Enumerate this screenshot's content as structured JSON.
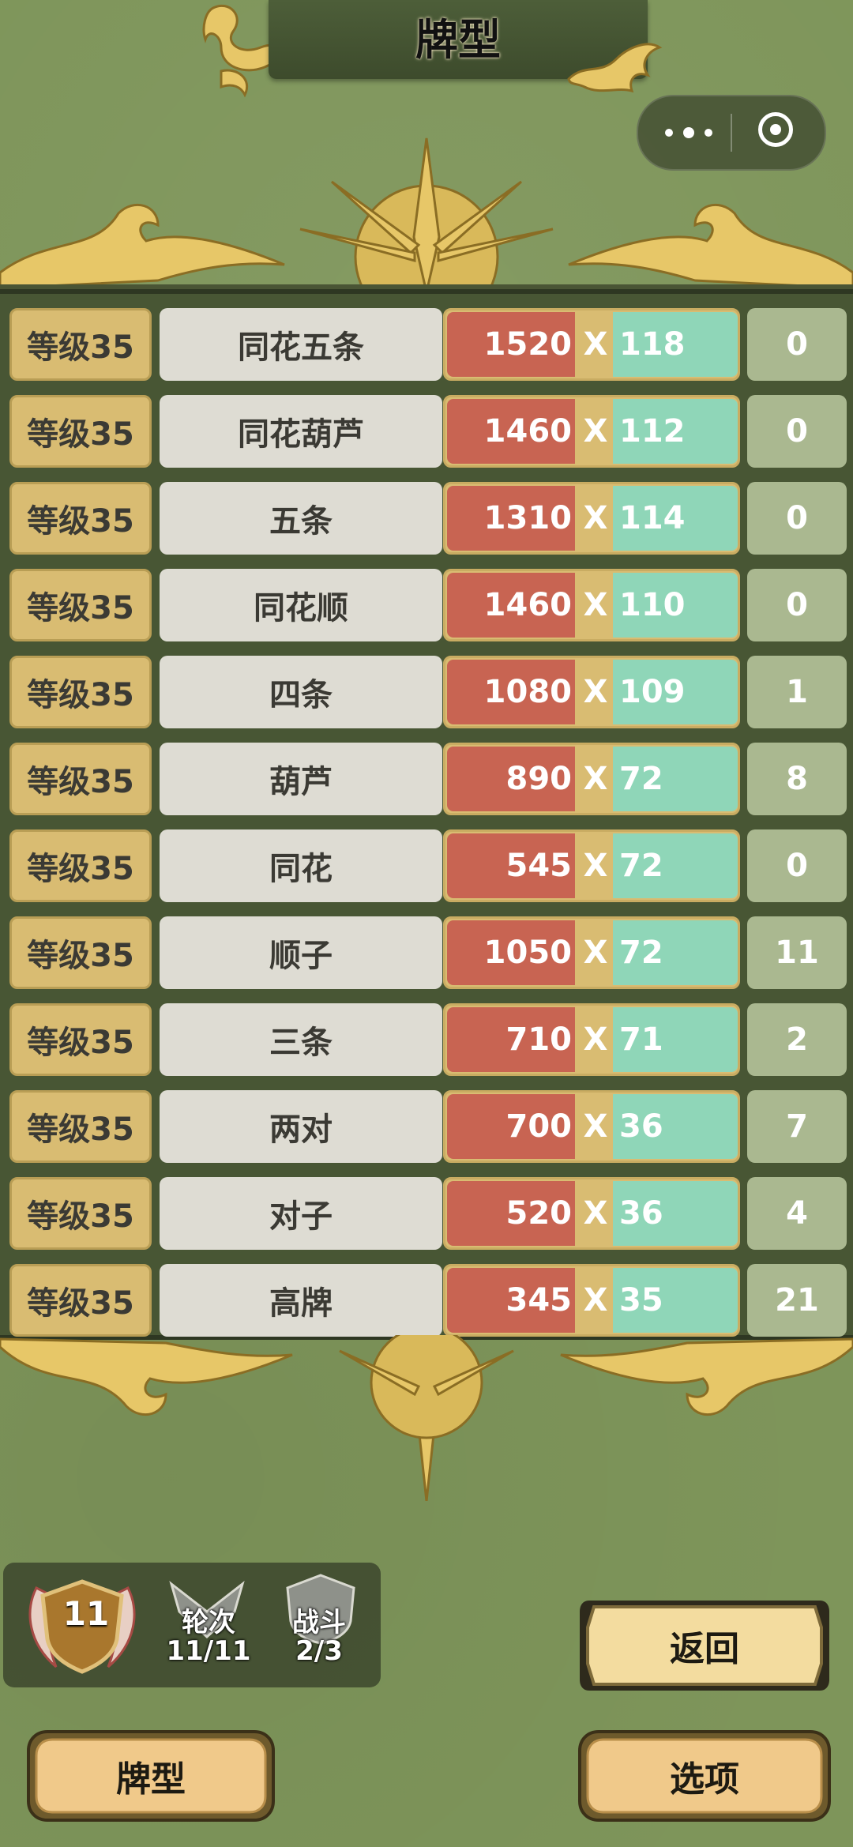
{
  "title": "牌型",
  "capsule": {
    "more_icon": "more-dots-icon",
    "close_icon": "target-close-icon"
  },
  "hands": [
    {
      "level": "等级35",
      "name": "同花五条",
      "chips": "1520",
      "x": "X",
      "mult": "118",
      "count": "0"
    },
    {
      "level": "等级35",
      "name": "同花葫芦",
      "chips": "1460",
      "x": "X",
      "mult": "112",
      "count": "0"
    },
    {
      "level": "等级35",
      "name": "五条",
      "chips": "1310",
      "x": "X",
      "mult": "114",
      "count": "0"
    },
    {
      "level": "等级35",
      "name": "同花顺",
      "chips": "1460",
      "x": "X",
      "mult": "110",
      "count": "0"
    },
    {
      "level": "等级35",
      "name": "四条",
      "chips": "1080",
      "x": "X",
      "mult": "109",
      "count": "1"
    },
    {
      "level": "等级35",
      "name": "葫芦",
      "chips": "890",
      "x": "X",
      "mult": "72",
      "count": "8"
    },
    {
      "level": "等级35",
      "name": "同花",
      "chips": "545",
      "x": "X",
      "mult": "72",
      "count": "0"
    },
    {
      "level": "等级35",
      "name": "顺子",
      "chips": "1050",
      "x": "X",
      "mult": "72",
      "count": "11"
    },
    {
      "level": "等级35",
      "name": "三条",
      "chips": "710",
      "x": "X",
      "mult": "71",
      "count": "2"
    },
    {
      "level": "等级35",
      "name": "两对",
      "chips": "700",
      "x": "X",
      "mult": "36",
      "count": "7"
    },
    {
      "level": "等级35",
      "name": "对子",
      "chips": "520",
      "x": "X",
      "mult": "36",
      "count": "4"
    },
    {
      "level": "等级35",
      "name": "高牌",
      "chips": "345",
      "x": "X",
      "mult": "35",
      "count": "21"
    }
  ],
  "status": {
    "level": "11",
    "round_label": "轮次",
    "round_value": "11/11",
    "battle_label": "战斗",
    "battle_value": "2/3"
  },
  "buttons": {
    "back": "返回",
    "hand_types": "牌型",
    "options": "选项"
  },
  "colors": {
    "background": "#7e955a",
    "panel": "#485634",
    "level_cell": "#d9bc72",
    "name_cell": "#dedcd3",
    "chips": "#c86452",
    "mult": "#8fd6b8",
    "count_cell": "#aab890",
    "gold": "#e7c768"
  }
}
